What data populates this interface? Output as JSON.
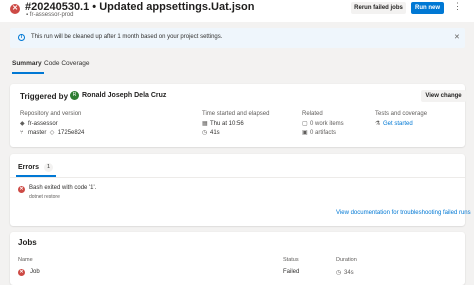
{
  "header": {
    "run_title": "#20240530.1 • Updated appsettings.Uat.json",
    "pipeline": "fr-assessor-prod",
    "rerun_label": "Rerun failed jobs",
    "run_new_label": "Run new",
    "more_label": "⋮",
    "status_glyph": "✕"
  },
  "banner": {
    "text": "This run will be cleaned up after 1 month based on your project settings.",
    "info_glyph": "i",
    "close_glyph": "✕"
  },
  "tabs": {
    "summary": "Summary",
    "coverage": "Code Coverage"
  },
  "summary": {
    "triggered_label": "Triggered by",
    "user": "Ronald Joseph Dela Cruz",
    "user_initial": "R",
    "view_change_label": "View change",
    "repo_head": "Repository and version",
    "repo": "fr-assessor",
    "branch": "master",
    "commit": "1725e824",
    "time_head": "Time started and elapsed",
    "started": "Thu at 10:56",
    "elapsed": "41s",
    "related_head": "Related",
    "work_items": "0 work items",
    "artifacts": "0 artifacts",
    "tests_head": "Tests and coverage",
    "tests_link": "Get started"
  },
  "errors": {
    "tab_label": "Errors",
    "count": "1",
    "message": "Bash exited with code '1'.",
    "source": "dotnet restore",
    "doc_link": "View documentation for troubleshooting failed runs"
  },
  "jobs": {
    "title": "Jobs",
    "col_name": "Name",
    "col_status": "Status",
    "col_duration": "Duration",
    "rows": [
      {
        "name": "Job",
        "status": "Failed",
        "duration": "34s"
      }
    ]
  },
  "colors": {
    "accent": "#0078d4",
    "failed": "#cd4a45",
    "avatar": "#2e7d32"
  }
}
